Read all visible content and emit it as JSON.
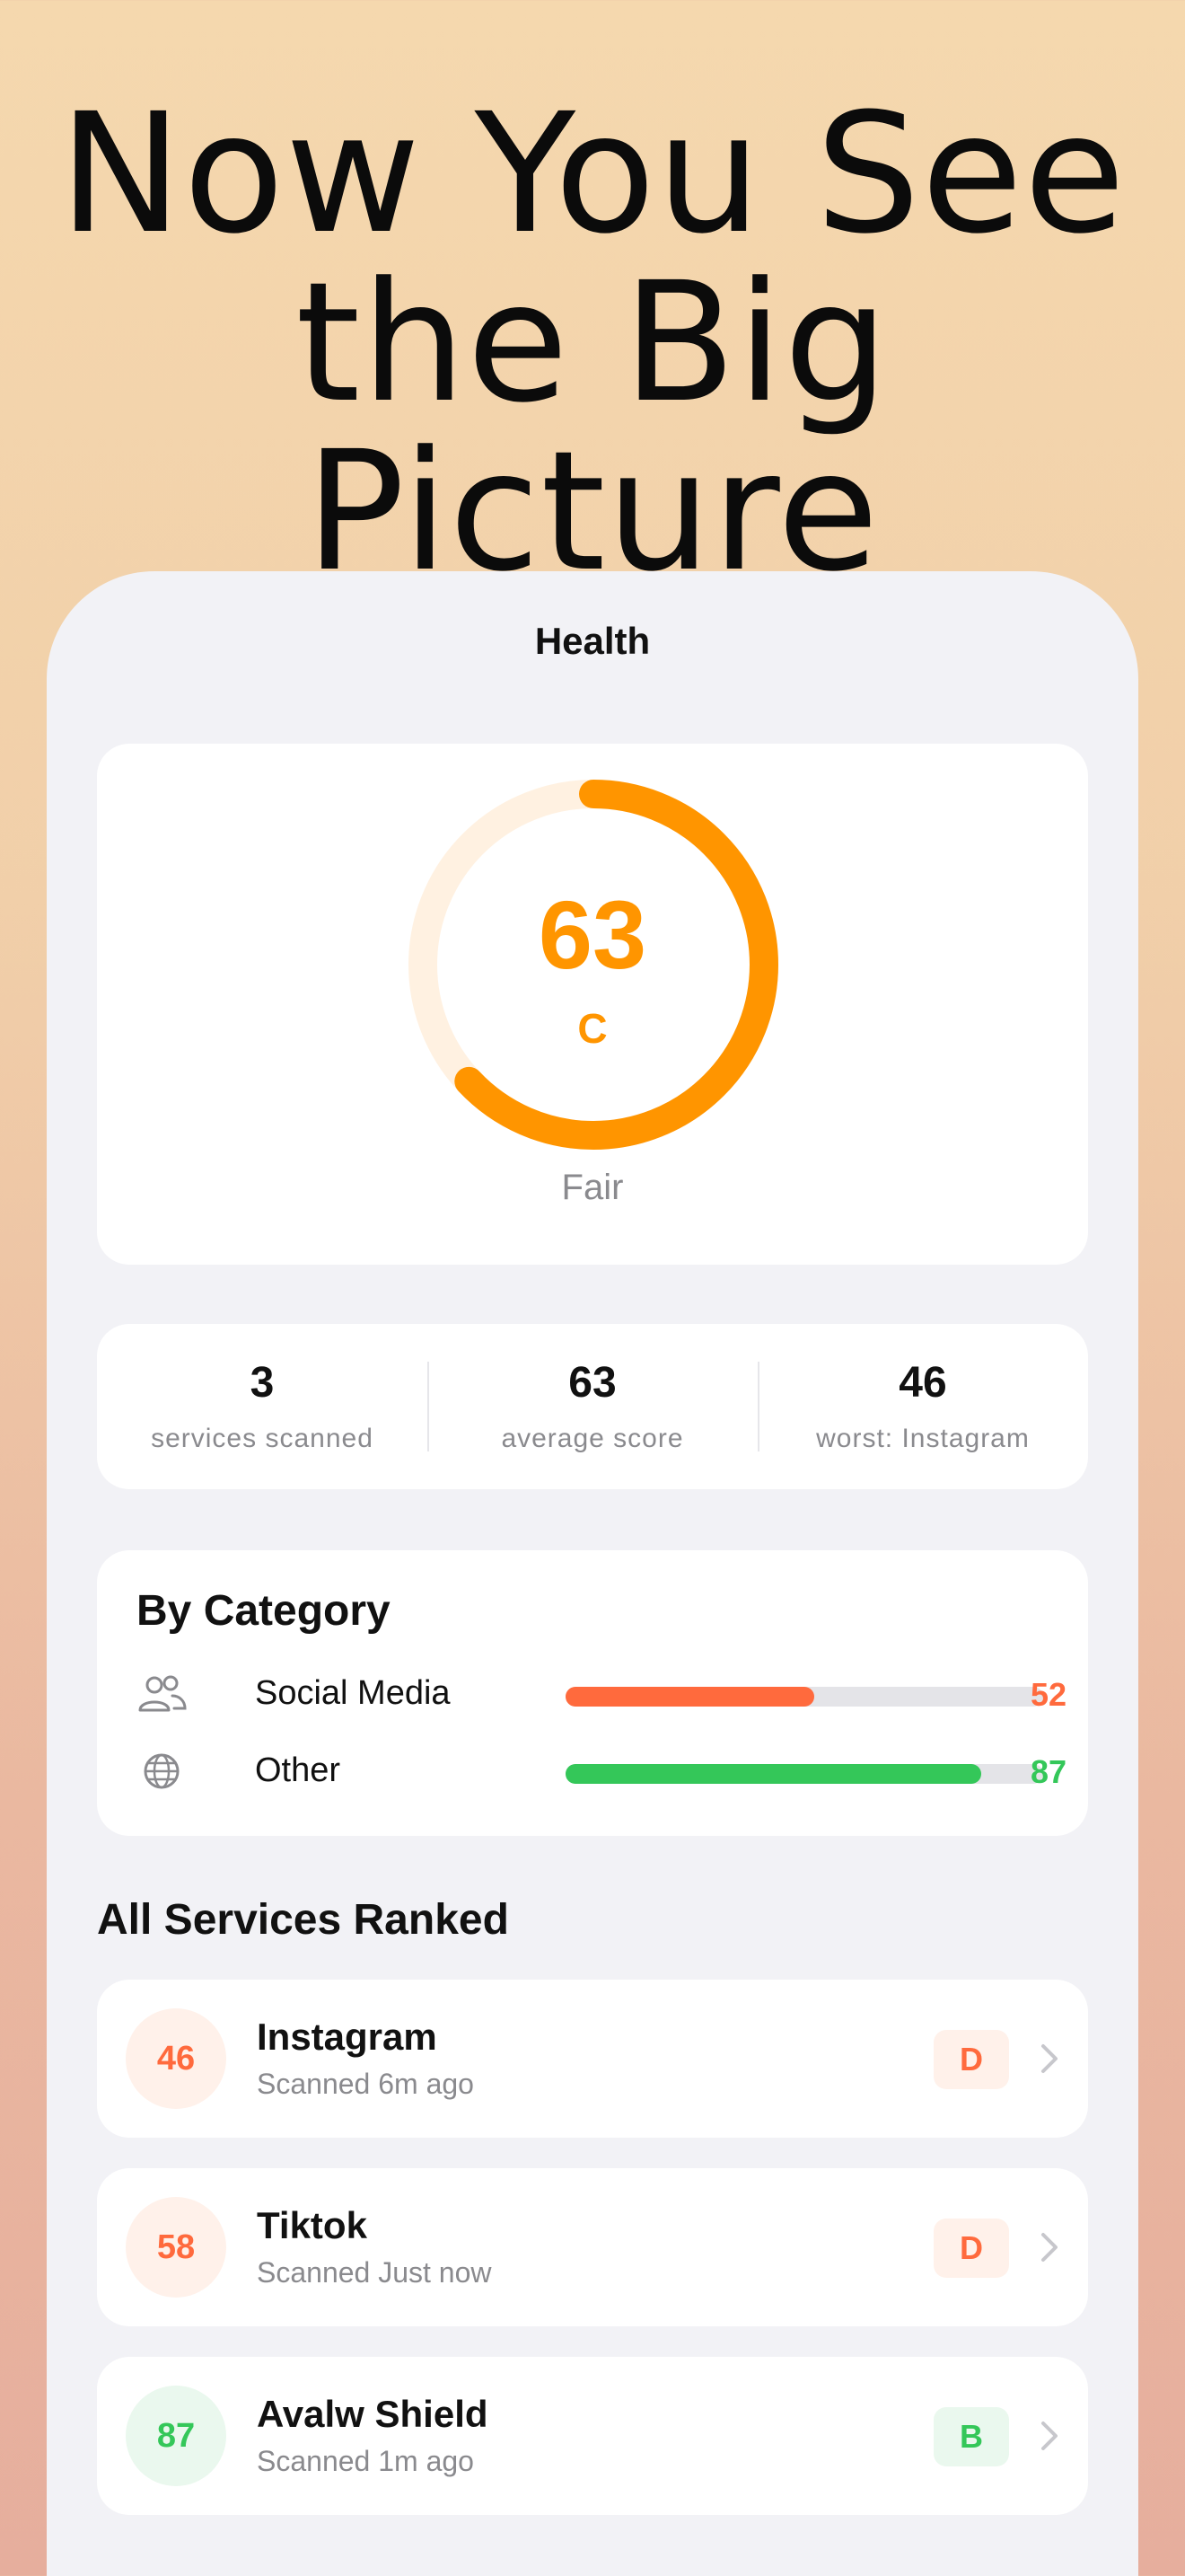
{
  "hero": {
    "line1": "Now You See",
    "line2": "the Big Picture"
  },
  "nav": {
    "title": "Health"
  },
  "score": {
    "value": "63",
    "grade": "C",
    "status": "Fair",
    "progress": 0.63,
    "color": "#ff9500",
    "track_color": "#fff1e1"
  },
  "stats": [
    {
      "value": "3",
      "label": "services scanned"
    },
    {
      "value": "63",
      "label": "average score"
    },
    {
      "value": "46",
      "label": "worst: Instagram"
    }
  ],
  "categories": {
    "title": "By Category",
    "items": [
      {
        "icon": "people-icon",
        "label": "Social Media",
        "score": "52",
        "fraction": 0.52,
        "color": "#ff6a3d"
      },
      {
        "icon": "globe-icon",
        "label": "Other",
        "score": "87",
        "fraction": 0.87,
        "color": "#34c759"
      }
    ]
  },
  "services": {
    "title": "All Services Ranked",
    "items": [
      {
        "score": "46",
        "name": "Instagram",
        "time": "Scanned 6m ago",
        "grade": "D",
        "tone": "orange"
      },
      {
        "score": "58",
        "name": "Tiktok",
        "time": "Scanned Just now",
        "grade": "D",
        "tone": "orange"
      },
      {
        "score": "87",
        "name": "Avalw Shield",
        "time": "Scanned 1m ago",
        "grade": "B",
        "tone": "green"
      }
    ]
  }
}
